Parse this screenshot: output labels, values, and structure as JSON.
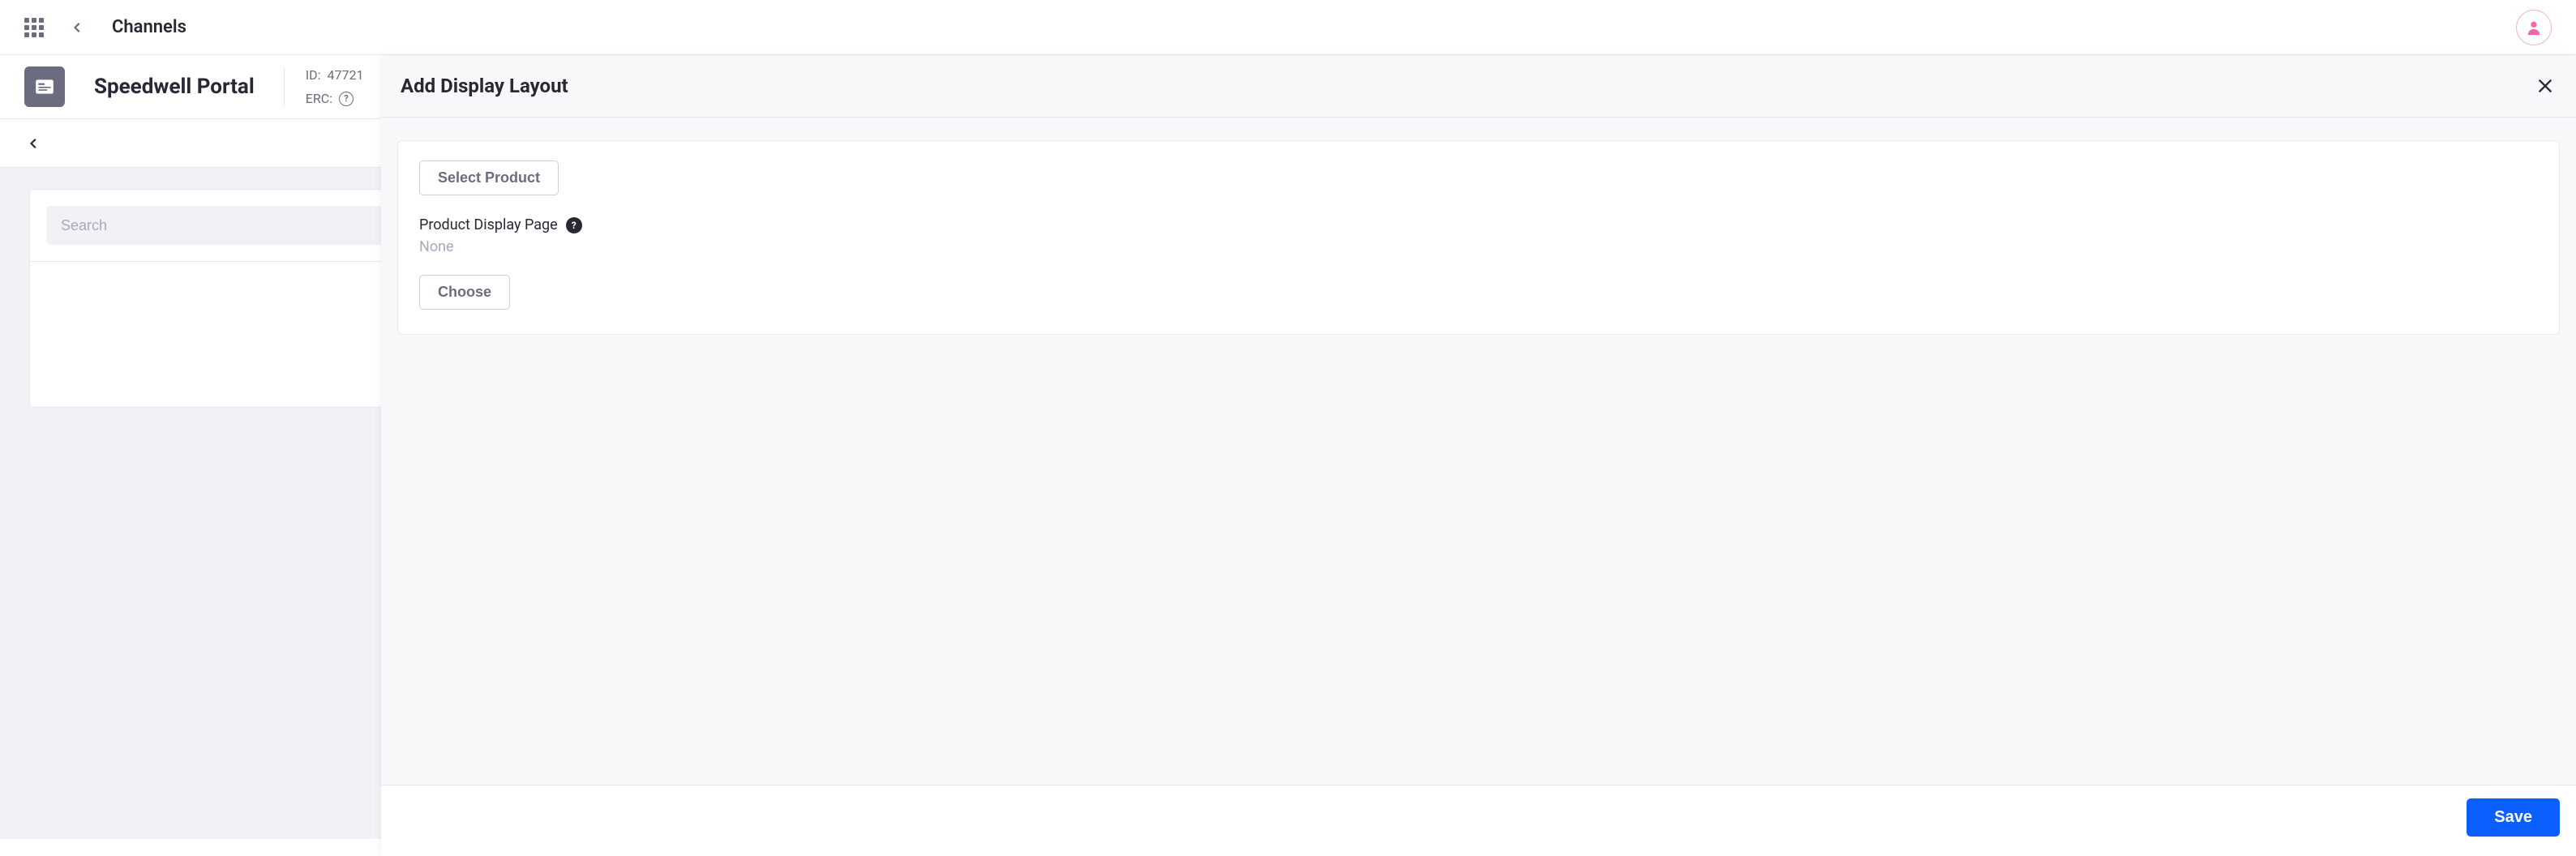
{
  "header": {
    "title": "Channels"
  },
  "channel": {
    "name": "Speedwell Portal",
    "id_label": "ID:",
    "id_value": "47721",
    "erc_label": "ERC:"
  },
  "search": {
    "placeholder": "Search"
  },
  "panel": {
    "title": "Add Display Layout",
    "select_product_label": "Select Product",
    "field_label": "Product Display Page",
    "field_value": "None",
    "choose_label": "Choose",
    "save_label": "Save"
  }
}
